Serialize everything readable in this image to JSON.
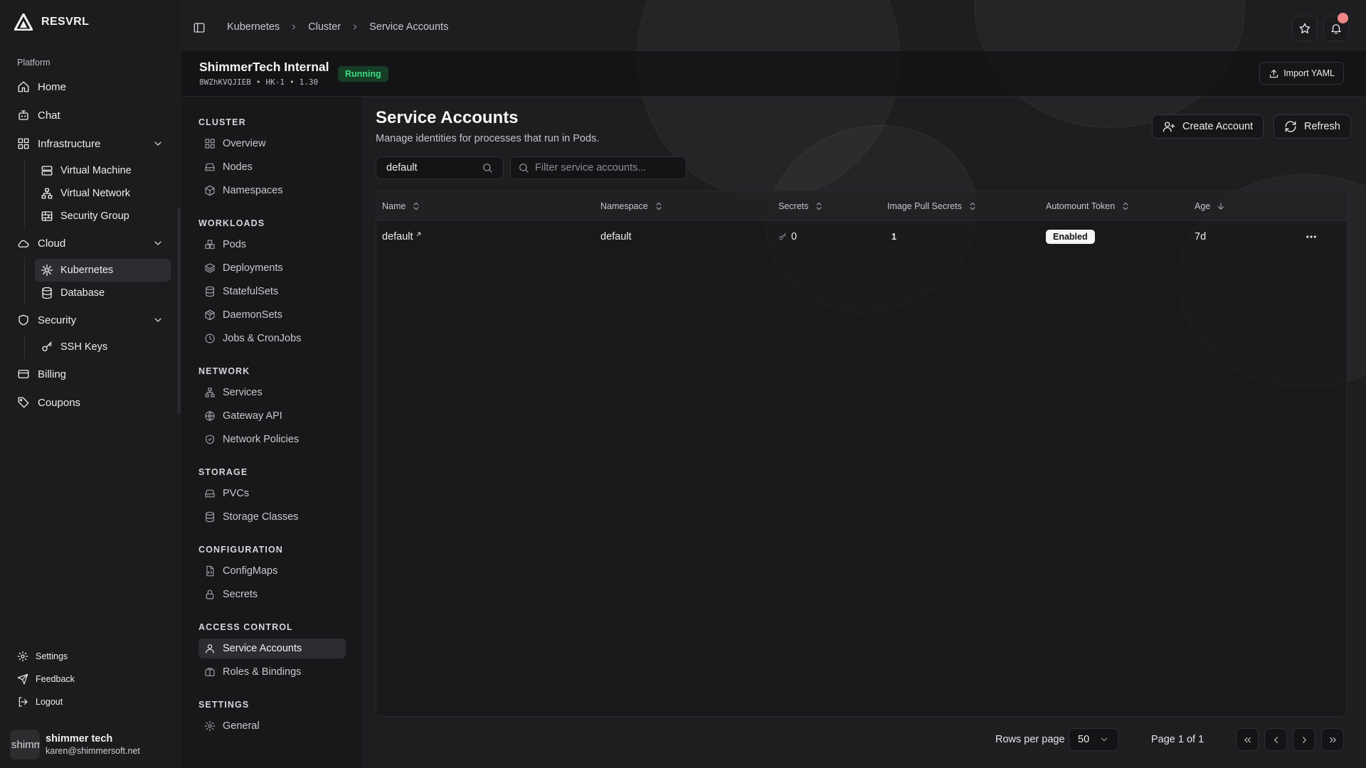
{
  "app": {
    "brand": "RESVRL"
  },
  "sidebar": {
    "section_label": "Platform",
    "items": {
      "home": "Home",
      "chat": "Chat",
      "infrastructure": "Infrastructure",
      "virtual_machine": "Virtual Machine",
      "virtual_network": "Virtual Network",
      "security_group": "Security Group",
      "cloud": "Cloud",
      "kubernetes": "Kubernetes",
      "database": "Database",
      "security": "Security",
      "ssh_keys": "SSH Keys",
      "billing": "Billing",
      "coupons": "Coupons"
    },
    "footer": {
      "settings": "Settings",
      "feedback": "Feedback",
      "logout": "Logout"
    },
    "user": {
      "avatar_text": "shimmer tech",
      "name": "shimmer tech",
      "email": "karen@shimmersoft.net"
    }
  },
  "breadcrumb": [
    "Kubernetes",
    "Cluster",
    "Service Accounts"
  ],
  "cluster": {
    "name": "ShimmerTech Internal",
    "id": "8WZhKVQJIEB",
    "region": "HK-1",
    "version": "1.30",
    "meta_sep": "•",
    "status": "Running",
    "import_label": "Import YAML"
  },
  "cluster_nav": {
    "cluster": {
      "label": "CLUSTER",
      "items": [
        "Overview",
        "Nodes",
        "Namespaces"
      ]
    },
    "workloads": {
      "label": "WORKLOADS",
      "items": [
        "Pods",
        "Deployments",
        "StatefulSets",
        "DaemonSets",
        "Jobs & CronJobs"
      ]
    },
    "network": {
      "label": "NETWORK",
      "items": [
        "Services",
        "Gateway API",
        "Network Policies"
      ]
    },
    "storage": {
      "label": "STORAGE",
      "items": [
        "PVCs",
        "Storage Classes"
      ]
    },
    "configuration": {
      "label": "CONFIGURATION",
      "items": [
        "ConfigMaps",
        "Secrets"
      ]
    },
    "access_control": {
      "label": "ACCESS CONTROL",
      "items": [
        "Service Accounts",
        "Roles & Bindings"
      ]
    },
    "settings": {
      "label": "SETTINGS",
      "items": [
        "General"
      ]
    }
  },
  "page": {
    "title": "Service Accounts",
    "subtitle": "Manage identities for processes that run in Pods.",
    "create_label": "Create Account",
    "refresh_label": "Refresh",
    "namespace_value": "default",
    "filter_placeholder": "Filter service accounts..."
  },
  "table": {
    "columns": {
      "name": "Name",
      "namespace": "Namespace",
      "secrets": "Secrets",
      "image_pull_secrets": "Image Pull Secrets",
      "automount": "Automount Token",
      "age": "Age"
    },
    "rows": [
      {
        "name": "default",
        "namespace": "default",
        "secrets": "0",
        "image_pull_secrets": "1",
        "automount": "Enabled",
        "age": "7d"
      }
    ]
  },
  "pagination": {
    "rows_label": "Rows per page",
    "rows_value": "50",
    "page_info": "Page 1 of 1"
  },
  "colors": {
    "background": "#1a1a1c",
    "status_running_bg": "#163d26",
    "status_running_fg": "#3ddc84",
    "notification_dot": "#f08586"
  }
}
